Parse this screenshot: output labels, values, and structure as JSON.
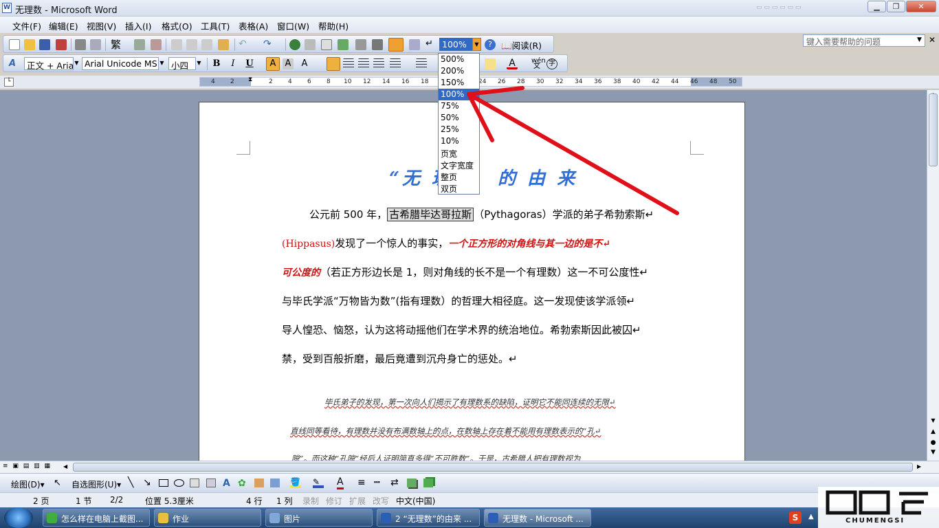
{
  "window": {
    "title": "无理数 - Microsoft Word",
    "min": "▁",
    "max": "❐",
    "close": "✕"
  },
  "menu": [
    "文件(F)",
    "编辑(E)",
    "视图(V)",
    "插入(I)",
    "格式(O)",
    "工具(T)",
    "表格(A)",
    "窗口(W)",
    "帮助(H)"
  ],
  "help_placeholder": "键入需要帮助的问题",
  "toolbar": {
    "zoom_value": "100%",
    "read_label": "阅读(R)",
    "trad_char": "繁"
  },
  "format_bar": {
    "style": "正文 + Aria",
    "font": "Arial Unicode MS",
    "size": "小四"
  },
  "zoom_options": [
    "500%",
    "200%",
    "150%",
    "100%",
    "75%",
    "50%",
    "25%",
    "10%",
    "页宽",
    "文字宽度",
    "整页",
    "双页"
  ],
  "zoom_selected_index": 3,
  "ruler_ticks": [
    "4",
    "2",
    "2",
    "4",
    "6",
    "8",
    "10",
    "12",
    "14",
    "16",
    "18",
    "24",
    "26",
    "28",
    "30",
    "32",
    "34",
    "36",
    "38",
    "40",
    "42",
    "44",
    "46",
    "48",
    "50"
  ],
  "doc": {
    "heading_left": "“无 理",
    "heading_right": "的 由 来",
    "p1_prefix": "公元前 500 年，",
    "p1_box": "古希腊毕达哥拉斯",
    "p1_suffix": "（Pythagoras）学派的弟子希勃索斯↵",
    "p2_paren": "(Hippasus)",
    "p2_text": "发现了一个惊人的事实，",
    "p2_red": "一个正方形的对角线与其一边的是不↵",
    "p3_red": "可公度的",
    "p3_text": "（若正方形边长是 1，则对角线的长不是一个有理数）这一不可公度性↵",
    "p4": "与毕氏学派“万物皆为数”(指有理数）的哲理大相径庭。这一发现使该学派领↵",
    "p5": "导人惶恐、恼怒，认为这将动摇他们在学术界的统治地位。希勃索斯因此被囚↵",
    "p6": "禁，受到百般折磨，最后竟遭到沉舟身亡的惩处。↵",
    "c1": "毕氏弟子的发现，第一次向人们揭示了有理数系的缺陷，证明它不能同连续的无限↵",
    "c2": "直线同等看待，有理数并没有布满数轴上的点，在数轴上存在着不能用有理数表示的“孔↵",
    "c3": "隙”。而这种“孔隙”经后人证明简直多得“不可胜数”。于是，古希腊人把有理数视为"
  },
  "drawbar": {
    "draw": "绘图(D)▾",
    "autoshape": "自选图形(U)▾"
  },
  "status": {
    "page": "2 页",
    "section": "1 节",
    "pages": "2/2",
    "position": "位置 5.3厘米",
    "line": "4 行",
    "col": "1 列",
    "rec": "录制",
    "trk": "修订",
    "ext": "扩展",
    "ovr": "改写",
    "lang": "中文(中国)"
  },
  "taskbar": [
    {
      "label": "怎么样在电脑上截图...",
      "color": "#3fae3f"
    },
    {
      "label": "作业",
      "color": "#e8c040"
    },
    {
      "label": "图片",
      "color": "#7fa7d8"
    },
    {
      "label": "2 “无理数”的由来 ...",
      "color": "#2b5fb4"
    },
    {
      "label": "无理数 - Microsoft ...",
      "color": "#2b5fb4"
    }
  ],
  "watermark": {
    "brand": "CHUMENGSI"
  },
  "colors": {
    "accent": "#316ac5",
    "red_text": "#d21010",
    "heading_blue": "#2f6fd6",
    "annotation_red": "#e0101a"
  }
}
